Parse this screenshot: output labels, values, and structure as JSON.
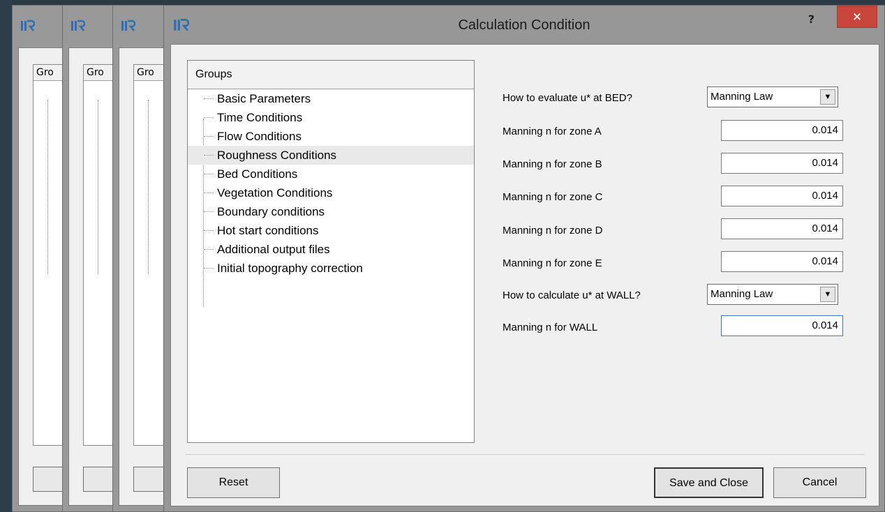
{
  "window": {
    "title": "Calculation Condition",
    "help_label": "?",
    "close_label": "✕"
  },
  "background_windows": {
    "groups_label": "Gro"
  },
  "groups": {
    "header": "Groups",
    "items": [
      {
        "label": "Basic Parameters"
      },
      {
        "label": "Time Conditions"
      },
      {
        "label": "Flow Conditions"
      },
      {
        "label": "Roughness Conditions"
      },
      {
        "label": "Bed Conditions"
      },
      {
        "label": "Vegetation Conditions"
      },
      {
        "label": "Boundary conditions"
      },
      {
        "label": "Hot start conditions"
      },
      {
        "label": "Additional output files"
      },
      {
        "label": "Initial topography correction"
      }
    ],
    "selected": "Roughness Conditions"
  },
  "form": {
    "bed_method": {
      "label": "How to evaluate u* at BED?",
      "value": "Manning Law"
    },
    "zone_a": {
      "label": "Manning n for zone A",
      "value": "0.014"
    },
    "zone_b": {
      "label": "Manning n for zone B",
      "value": "0.014"
    },
    "zone_c": {
      "label": "Manning n for zone C",
      "value": "0.014"
    },
    "zone_d": {
      "label": "Manning n for zone D",
      "value": "0.014"
    },
    "zone_e": {
      "label": "Manning n for zone E",
      "value": "0.014"
    },
    "wall_method": {
      "label": "How to calculate u* at WALL?",
      "value": "Manning Law"
    },
    "wall": {
      "label": "Manning n for WALL",
      "value": "0.014"
    }
  },
  "buttons": {
    "reset": "Reset",
    "save_close": "Save and Close",
    "cancel": "Cancel"
  },
  "colors": {
    "close_button": "#c9463d",
    "window_frame": "#979797",
    "dialog_bg": "#f0f0f0",
    "app_icon": "#2f6db5"
  }
}
